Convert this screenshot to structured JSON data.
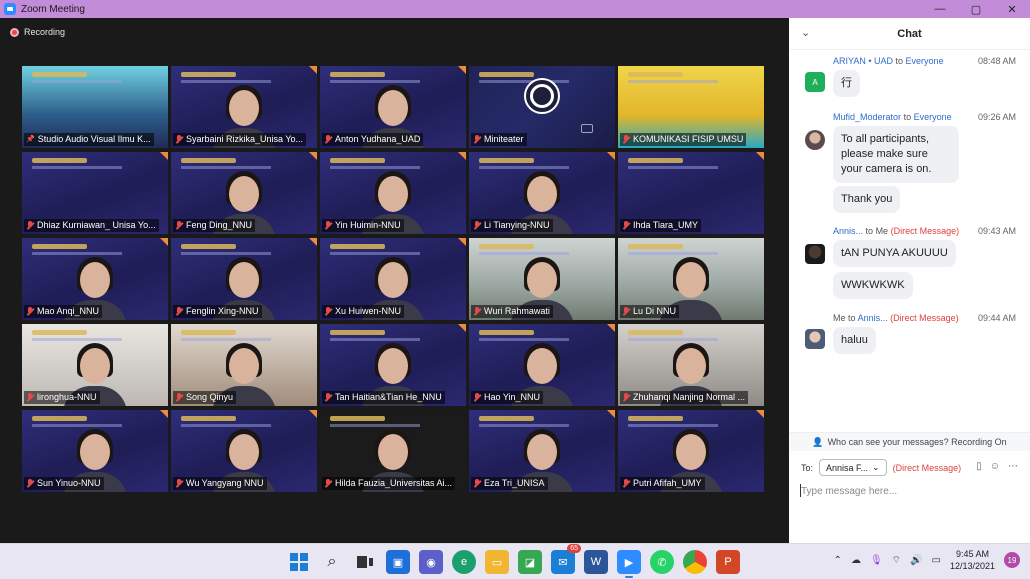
{
  "window": {
    "title": "Zoom Meeting",
    "controls": [
      "—",
      "▢",
      "✕"
    ]
  },
  "recording": {
    "label": "Recording"
  },
  "participants": [
    {
      "name": "Studio Audio Visual Ilmu K...",
      "bg": "bg-studio",
      "active": true,
      "muted": false
    },
    {
      "name": "Syarbaini Rizkika_Unisa Yo...",
      "bg": "",
      "active": false,
      "muted": true
    },
    {
      "name": "Anton Yudhana_UAD",
      "bg": "",
      "active": false,
      "muted": true
    },
    {
      "name": "Miniteater",
      "bg": "bg-obs",
      "active": false,
      "muted": true,
      "obs": true
    },
    {
      "name": "KOMUNIKASI FISIP UMSU",
      "bg": "bg-yellow",
      "active": false,
      "muted": true
    },
    {
      "name": "Dhiaz Kurniawan_ Unisa Yo...",
      "bg": "",
      "active": false,
      "muted": true,
      "nobody": true
    },
    {
      "name": "Feng Ding_NNU",
      "bg": "",
      "active": false,
      "muted": true
    },
    {
      "name": "Yin Huimin-NNU",
      "bg": "",
      "active": false,
      "muted": true
    },
    {
      "name": "Li Tianying-NNU",
      "bg": "",
      "active": false,
      "muted": true
    },
    {
      "name": "Ihda Tiara_UMY",
      "bg": "",
      "active": false,
      "muted": true,
      "nobody": true
    },
    {
      "name": "Mao Anqi_NNU",
      "bg": "",
      "active": false,
      "muted": true
    },
    {
      "name": "Fenglin Xing-NNU",
      "bg": "",
      "active": false,
      "muted": true
    },
    {
      "name": "Xu Huiwen-NNU",
      "bg": "",
      "active": false,
      "muted": true
    },
    {
      "name": "Wuri Rahmawati",
      "bg": "bg-photo1",
      "active": false,
      "muted": true
    },
    {
      "name": "Lu Di NNU",
      "bg": "bg-photo1",
      "active": false,
      "muted": true
    },
    {
      "name": "lironghua-NNU",
      "bg": "bg-photo2",
      "active": false,
      "muted": true
    },
    {
      "name": "Song Qinyu",
      "bg": "bg-photo3",
      "active": false,
      "muted": true
    },
    {
      "name": "Tan Haitian&Tian He_NNU",
      "bg": "",
      "active": false,
      "muted": true
    },
    {
      "name": "Hao Yin_NNU",
      "bg": "",
      "active": false,
      "muted": true
    },
    {
      "name": "Zhuhanqi Nanjing Normal ...",
      "bg": "bg-photo4",
      "active": false,
      "muted": true
    },
    {
      "name": "Sun Yinuo-NNU",
      "bg": "",
      "active": false,
      "muted": true
    },
    {
      "name": "Wu Yangyang  NNU",
      "bg": "",
      "active": false,
      "muted": true
    },
    {
      "name": "Hilda Fauzia_Universitas Ai...",
      "bg": "bg-dark",
      "active": false,
      "muted": true
    },
    {
      "name": "Eza Tri_UNISA",
      "bg": "",
      "active": false,
      "muted": true
    },
    {
      "name": "Putri Afifah_UMY",
      "bg": "",
      "active": false,
      "muted": true
    }
  ],
  "chat": {
    "title": "Chat",
    "messages": [
      {
        "from": "ARIYAN • UAD",
        "to_word": "to",
        "target": "Everyone",
        "dm": "",
        "time": "08:48 AM",
        "avatar": "A",
        "bubbles": [
          "行"
        ]
      },
      {
        "from": "Mufid_Moderator",
        "to_word": "to",
        "target": "Everyone",
        "dm": "",
        "time": "09:26 AM",
        "avatar": "",
        "bubbles": [
          "To all participants, please make sure your camera is on.",
          "Thank you"
        ]
      },
      {
        "from": "Annis...",
        "to_word": "to",
        "target": "Me",
        "dm": "(Direct Message)",
        "time": "09:43 AM",
        "avatar": "",
        "bubbles": [
          "tAN PUNYA AKUUUU",
          "WWKWKWK"
        ]
      },
      {
        "from": "Me",
        "to_word": "to",
        "target": "Annis...",
        "dm": "(Direct Message)",
        "time": "09:44 AM",
        "avatar": "",
        "bubbles": [
          "haluu"
        ]
      }
    ],
    "privacy_text": "Who can see your messages? Recording On",
    "to_label": "To:",
    "to_value": "Annisa F...",
    "to_dm": "(Direct Message)",
    "input_placeholder": "Type message here..."
  },
  "taskbar": {
    "mail_badge": "65",
    "time": "9:45 AM",
    "date": "12/13/2021",
    "notifications": "19"
  }
}
